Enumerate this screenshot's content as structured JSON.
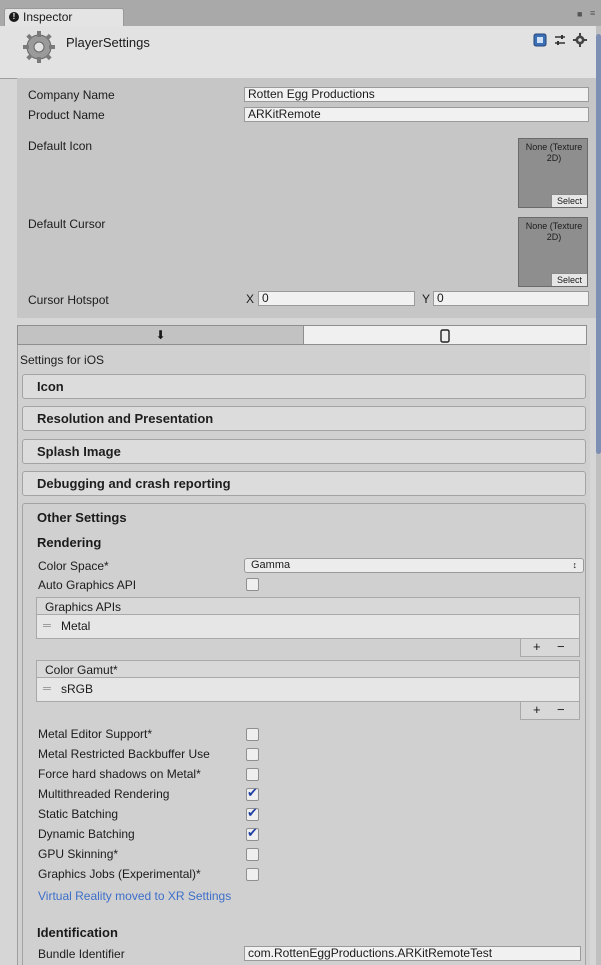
{
  "window": {
    "tab_label": "Inspector",
    "tab_icon": "info-circle-icon"
  },
  "header": {
    "title": "PlayerSettings",
    "icons": [
      "book-help-icon",
      "sliders-icon",
      "gear-icon"
    ]
  },
  "fields": {
    "company_label": "Company Name",
    "company_value": "Rotten Egg Productions",
    "product_label": "Product Name",
    "product_value": "ARKitRemote",
    "default_icon_label": "Default Icon",
    "default_cursor_label": "Default Cursor",
    "texture_none_line1": "None (Texture",
    "texture_none_line2": "2D)",
    "texture_select": "Select",
    "hotspot_label": "Cursor Hotspot",
    "hotspot_x_label": "X",
    "hotspot_x_value": "0",
    "hotspot_y_label": "Y",
    "hotspot_y_value": "0"
  },
  "platform_tabs": {
    "standalone_icon": "download-arrow-icon",
    "ios_icon": "phone-icon",
    "selected": "ios"
  },
  "settings": {
    "heading": "Settings for iOS",
    "sections": [
      "Icon",
      "Resolution and Presentation",
      "Splash Image",
      "Debugging and crash reporting"
    ],
    "other_settings": "Other Settings",
    "rendering": "Rendering",
    "color_space_label": "Color Space*",
    "color_space_value": "Gamma",
    "auto_graphics_label": "Auto Graphics API",
    "graphics_apis_header": "Graphics APIs",
    "graphics_apis_item": "Metal",
    "color_gamut_header": "Color Gamut*",
    "color_gamut_item": "sRGB",
    "list_add": "+",
    "list_remove": "−",
    "toggles": [
      {
        "label": "Metal Editor Support*",
        "checked": false
      },
      {
        "label": "Metal Restricted Backbuffer Use",
        "checked": false
      },
      {
        "label": "Force hard shadows on Metal*",
        "checked": false
      },
      {
        "label": "Multithreaded Rendering",
        "checked": true
      },
      {
        "label": "Static Batching",
        "checked": true
      },
      {
        "label": "Dynamic Batching",
        "checked": true
      },
      {
        "label": "GPU Skinning*",
        "checked": false
      },
      {
        "label": "Graphics Jobs (Experimental)*",
        "checked": false
      }
    ],
    "vr_link": "Virtual Reality moved to XR Settings",
    "identification": "Identification",
    "bundle_label": "Bundle Identifier",
    "bundle_value": "com.RottenEggProductions.ARKitRemoteTest"
  }
}
